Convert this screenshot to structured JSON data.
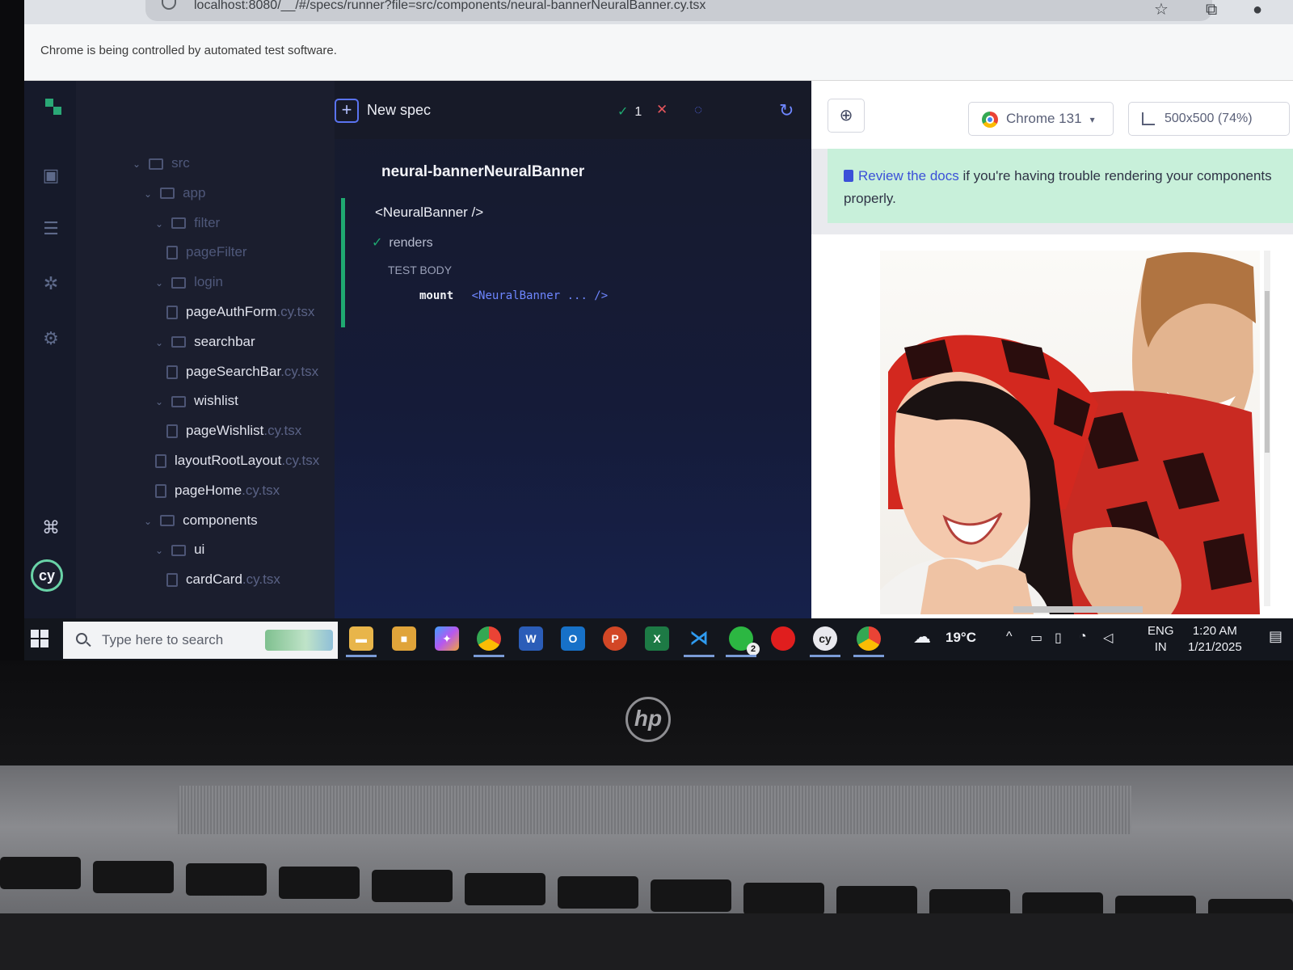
{
  "browser": {
    "url": "localhost:8080/__/#/specs/runner?file=src/components/neural-bannerNeuralBanner.cy.tsx",
    "automation_notice": "Chrome is being controlled by automated test software."
  },
  "file_tree": {
    "items": [
      {
        "label": "src",
        "ext": "",
        "depth": 0,
        "type": "folder",
        "faded": true
      },
      {
        "label": "app",
        "ext": "",
        "depth": 1,
        "type": "folder",
        "faded": true
      },
      {
        "label": "filter",
        "ext": "",
        "depth": 2,
        "type": "folder",
        "faded": true
      },
      {
        "label": "pageFilter",
        "ext": "",
        "depth": 3,
        "type": "file",
        "faded": true
      },
      {
        "label": "login",
        "ext": "",
        "depth": 2,
        "type": "folder",
        "faded": true
      },
      {
        "label": "pageAuthForm",
        "ext": ".cy.tsx",
        "depth": 3,
        "type": "file",
        "faded": false
      },
      {
        "label": "searchbar",
        "ext": "",
        "depth": 2,
        "type": "folder",
        "faded": false
      },
      {
        "label": "pageSearchBar",
        "ext": ".cy.tsx",
        "depth": 3,
        "type": "file",
        "faded": false
      },
      {
        "label": "wishlist",
        "ext": "",
        "depth": 2,
        "type": "folder",
        "faded": false
      },
      {
        "label": "pageWishlist",
        "ext": ".cy.tsx",
        "depth": 3,
        "type": "file",
        "faded": false
      },
      {
        "label": "layoutRootLayout",
        "ext": ".cy.tsx",
        "depth": 2,
        "type": "file",
        "faded": false
      },
      {
        "label": "pageHome",
        "ext": ".cy.tsx",
        "depth": 2,
        "type": "file",
        "faded": false
      },
      {
        "label": "components",
        "ext": "",
        "depth": 1,
        "type": "folder",
        "faded": false
      },
      {
        "label": "ui",
        "ext": "",
        "depth": 2,
        "type": "folder",
        "faded": false
      },
      {
        "label": "cardCard",
        "ext": ".cy.tsx",
        "depth": 3,
        "type": "file",
        "faded": false
      }
    ]
  },
  "reporter": {
    "new_spec_label": "New spec",
    "passed_count": "1",
    "failed_mark": "✕",
    "spec_title": "neural-bannerNeuralBanner",
    "suite_title": "<NeuralBanner />",
    "test_name": "renders",
    "test_body_label": "TEST BODY",
    "command_name": "mount",
    "command_arg": "<NeuralBanner ... />"
  },
  "aut": {
    "browser_label": "Chrome 131",
    "viewport_label": "500x500 (74%)",
    "docs_link": "Review the docs",
    "docs_text": " if you're having trouble rendering your components properly."
  },
  "taskbar": {
    "search_placeholder": "Type here to search",
    "weather": "19°C",
    "lang_top": "ENG",
    "lang_bottom": "IN",
    "time": "1:20 AM",
    "date": "1/21/2025",
    "notification_count": "2",
    "whatsapp_badge": "2"
  },
  "colors": {
    "cypress_bg": "#1b1e2e",
    "pass_green": "#1fa971",
    "fail_red": "#e3555c",
    "accent_indigo": "#5a73f0",
    "docs_banner": "#c8f0da"
  }
}
